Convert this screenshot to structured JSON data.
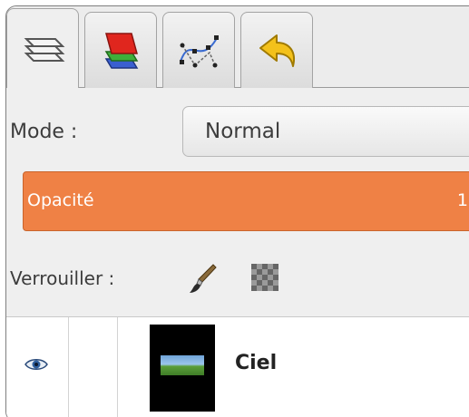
{
  "tabs": [
    {
      "name": "layers",
      "icon": "layers-icon",
      "active": true
    },
    {
      "name": "channels",
      "icon": "channels-icon",
      "active": false
    },
    {
      "name": "paths",
      "icon": "paths-icon",
      "active": false
    },
    {
      "name": "undo-history",
      "icon": "undo-history-icon",
      "active": false
    }
  ],
  "mode": {
    "label": "Mode :",
    "value": "Normal"
  },
  "opacity": {
    "label": "Opacité",
    "value_text": "1",
    "accent_color": "#ef8145"
  },
  "lock": {
    "label": "Verrouiller :",
    "icons": [
      "lock-pixels-brush-icon",
      "lock-alpha-checker-icon"
    ]
  },
  "layers": [
    {
      "name": "Ciel",
      "visible": true,
      "thumbnail": "sky-landscape-thumbnail"
    }
  ]
}
